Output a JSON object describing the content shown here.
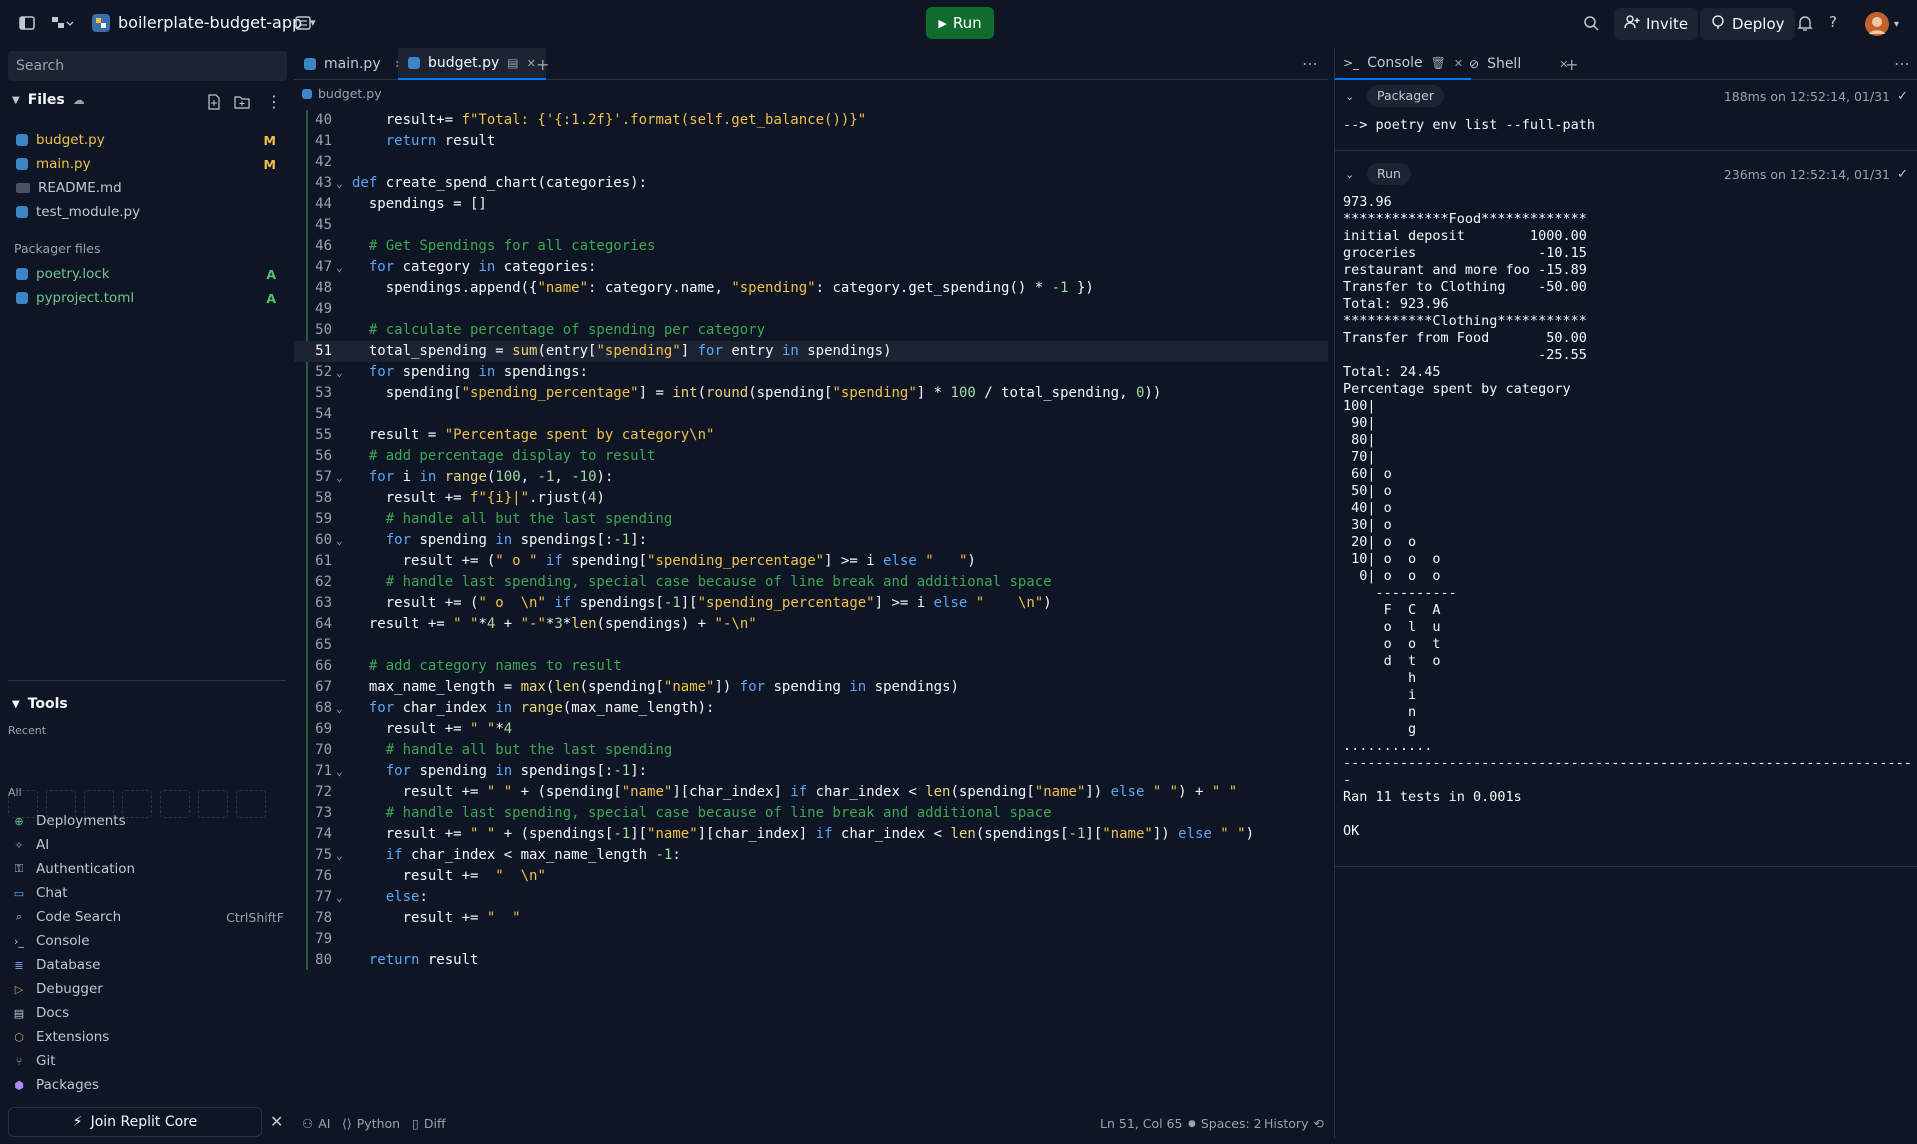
{
  "header": {
    "app_name": "boilerplate-budget-app",
    "run_label": "Run",
    "invite_label": "Invite",
    "deploy_label": "Deploy"
  },
  "sidebar": {
    "search_placeholder": "Search",
    "files_title": "Files",
    "files": [
      {
        "name": "budget.py",
        "status": "M"
      },
      {
        "name": "main.py",
        "status": "M"
      },
      {
        "name": "README.md",
        "status": ""
      },
      {
        "name": "test_module.py",
        "status": ""
      }
    ],
    "packager_title": "Packager files",
    "packager_files": [
      {
        "name": "poetry.lock",
        "status": "A"
      },
      {
        "name": "pyproject.toml",
        "status": "A"
      }
    ],
    "tools_title": "Tools",
    "recent_label": "Recent",
    "all_label": "All",
    "tools": [
      {
        "label": "Deployments",
        "icon": "deployments-icon"
      },
      {
        "label": "AI",
        "icon": "ai-icon"
      },
      {
        "label": "Authentication",
        "icon": "authentication-icon"
      },
      {
        "label": "Chat",
        "icon": "chat-icon"
      },
      {
        "label": "Code Search",
        "icon": "code-search-icon",
        "shortcut": "CtrlShiftF"
      },
      {
        "label": "Console",
        "icon": "console-icon"
      },
      {
        "label": "Database",
        "icon": "database-icon"
      },
      {
        "label": "Debugger",
        "icon": "debugger-icon"
      },
      {
        "label": "Docs",
        "icon": "docs-icon"
      },
      {
        "label": "Extensions",
        "icon": "extensions-icon"
      },
      {
        "label": "Git",
        "icon": "git-icon"
      },
      {
        "label": "Packages",
        "icon": "packages-icon"
      }
    ],
    "join_label": "Join Replit Core"
  },
  "editor": {
    "tabs": [
      {
        "label": "main.py"
      },
      {
        "label": "budget.py"
      }
    ],
    "breadcrumb": "budget.py",
    "current_line": 51
  },
  "statusbar": {
    "ai": "AI",
    "language": "Python",
    "diff": "Diff",
    "position": "Ln 51, Col 65",
    "spaces": "Spaces: 2",
    "history": "History"
  },
  "console": {
    "tabs": [
      {
        "label": "Console"
      },
      {
        "label": "Shell"
      }
    ],
    "packager": {
      "chip": "Packager",
      "timing": "188ms on 12:52:14, 01/31",
      "output": "--> poetry env list --full-path"
    },
    "run": {
      "chip": "Run",
      "timing": "236ms on 12:52:14, 01/31",
      "output": "973.96\n*************Food*************\ninitial deposit        1000.00\ngroceries               -10.15\nrestaurant and more foo -15.89\nTransfer to Clothing    -50.00\nTotal: 923.96\n***********Clothing***********\nTransfer from Food       50.00\n                        -25.55\nTotal: 24.45\nPercentage spent by category\n100|          \n 90|          \n 80|          \n 70|          \n 60| o        \n 50| o        \n 40| o        \n 30| o        \n 20| o  o     \n 10| o  o  o  \n  0| o  o  o  \n    ----------\n     F  C  A  \n     o  l  u  \n     o  o  t  \n     d  t  o  \n        h     \n        i     \n        n     \n        g     \n...........\n----------------------------------------------------------------------\n-\nRan 11 tests in 0.001s\n\nOK"
    }
  },
  "code_lines": [
    {
      "n": 40,
      "fold": false,
      "t": "    result+= f\"Total: {'{:1.2f}'.format(self.get_balance())}\""
    },
    {
      "n": 41,
      "fold": false,
      "t": "    return result"
    },
    {
      "n": 42,
      "fold": false,
      "t": ""
    },
    {
      "n": 43,
      "fold": true,
      "t": "def create_spend_chart(categories):"
    },
    {
      "n": 44,
      "fold": false,
      "t": "  spendings = []"
    },
    {
      "n": 45,
      "fold": false,
      "t": ""
    },
    {
      "n": 46,
      "fold": false,
      "t": "  # Get Spendings for all categories"
    },
    {
      "n": 47,
      "fold": true,
      "t": "  for category in categories:"
    },
    {
      "n": 48,
      "fold": false,
      "t": "    spendings.append({\"name\": category.name, \"spending\": category.get_spending() * -1 })"
    },
    {
      "n": 49,
      "fold": false,
      "t": ""
    },
    {
      "n": 50,
      "fold": false,
      "t": "  # calculate percentage of spending per category"
    },
    {
      "n": 51,
      "fold": false,
      "t": "  total_spending = sum(entry[\"spending\"] for entry in spendings)"
    },
    {
      "n": 52,
      "fold": true,
      "t": "  for spending in spendings:"
    },
    {
      "n": 53,
      "fold": false,
      "t": "    spending[\"spending_percentage\"] = int(round(spending[\"spending\"] * 100 / total_spending, 0))"
    },
    {
      "n": 54,
      "fold": false,
      "t": ""
    },
    {
      "n": 55,
      "fold": false,
      "t": "  result = \"Percentage spent by category\\n\""
    },
    {
      "n": 56,
      "fold": false,
      "t": "  # add percentage display to result"
    },
    {
      "n": 57,
      "fold": true,
      "t": "  for i in range(100, -1, -10):"
    },
    {
      "n": 58,
      "fold": false,
      "t": "    result += f\"{i}|\".rjust(4)"
    },
    {
      "n": 59,
      "fold": false,
      "t": "    # handle all but the last spending"
    },
    {
      "n": 60,
      "fold": true,
      "t": "    for spending in spendings[:-1]:"
    },
    {
      "n": 61,
      "fold": false,
      "t": "      result += (\" o \" if spending[\"spending_percentage\"] >= i else \"   \")"
    },
    {
      "n": 62,
      "fold": false,
      "t": "    # handle last spending, special case because of line break and additional space"
    },
    {
      "n": 63,
      "fold": false,
      "t": "    result += (\" o  \\n\" if spendings[-1][\"spending_percentage\"] >= i else \"    \\n\")"
    },
    {
      "n": 64,
      "fold": false,
      "t": "  result += \" \"*4 + \"-\"*3*len(spendings) + \"-\\n\""
    },
    {
      "n": 65,
      "fold": false,
      "t": ""
    },
    {
      "n": 66,
      "fold": false,
      "t": "  # add category names to result"
    },
    {
      "n": 67,
      "fold": false,
      "t": "  max_name_length = max(len(spending[\"name\"]) for spending in spendings)"
    },
    {
      "n": 68,
      "fold": true,
      "t": "  for char_index in range(max_name_length):"
    },
    {
      "n": 69,
      "fold": false,
      "t": "    result += \" \"*4"
    },
    {
      "n": 70,
      "fold": false,
      "t": "    # handle all but the last spending"
    },
    {
      "n": 71,
      "fold": true,
      "t": "    for spending in spendings[:-1]:"
    },
    {
      "n": 72,
      "fold": false,
      "t": "      result += \" \" + (spending[\"name\"][char_index] if char_index < len(spending[\"name\"]) else \" \") + \" \""
    },
    {
      "n": 73,
      "fold": false,
      "t": "    # handle last spending, special case because of line break and additional space"
    },
    {
      "n": 74,
      "fold": false,
      "t": "    result += \" \" + (spendings[-1][\"name\"][char_index] if char_index < len(spendings[-1][\"name\"]) else \" \")"
    },
    {
      "n": 75,
      "fold": true,
      "t": "    if char_index < max_name_length -1:"
    },
    {
      "n": 76,
      "fold": false,
      "t": "      result +=  \"  \\n\""
    },
    {
      "n": 77,
      "fold": true,
      "t": "    else:"
    },
    {
      "n": 78,
      "fold": false,
      "t": "      result += \"  \""
    },
    {
      "n": 79,
      "fold": false,
      "t": ""
    },
    {
      "n": 80,
      "fold": false,
      "t": "  return result"
    }
  ]
}
